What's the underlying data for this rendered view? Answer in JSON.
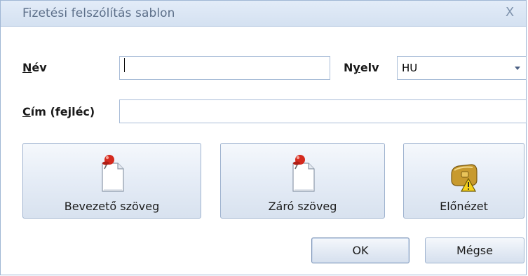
{
  "window": {
    "title": "Fizetési felszólítás sablon",
    "close_glyph": "X"
  },
  "form": {
    "name_label_accel": "N",
    "name_label_rest": "év",
    "name_value": "",
    "language_label_pre": "N",
    "language_label_accel": "y",
    "language_label_rest": "elv",
    "language_value": "HU",
    "title_label_accel": "C",
    "title_label_rest": "ím (fejléc)",
    "title_value": ""
  },
  "buttons": {
    "intro_text": "Bevezető szöveg",
    "closing_text": "Záró szöveg",
    "preview": "Előnézet",
    "ok": "OK",
    "cancel": "Mégse"
  },
  "icons": {
    "intro": "pinned-document-icon",
    "closing": "pinned-document-icon",
    "preview": "preview-warning-icon",
    "combo": "chevron-down-icon",
    "close": "close-icon"
  }
}
